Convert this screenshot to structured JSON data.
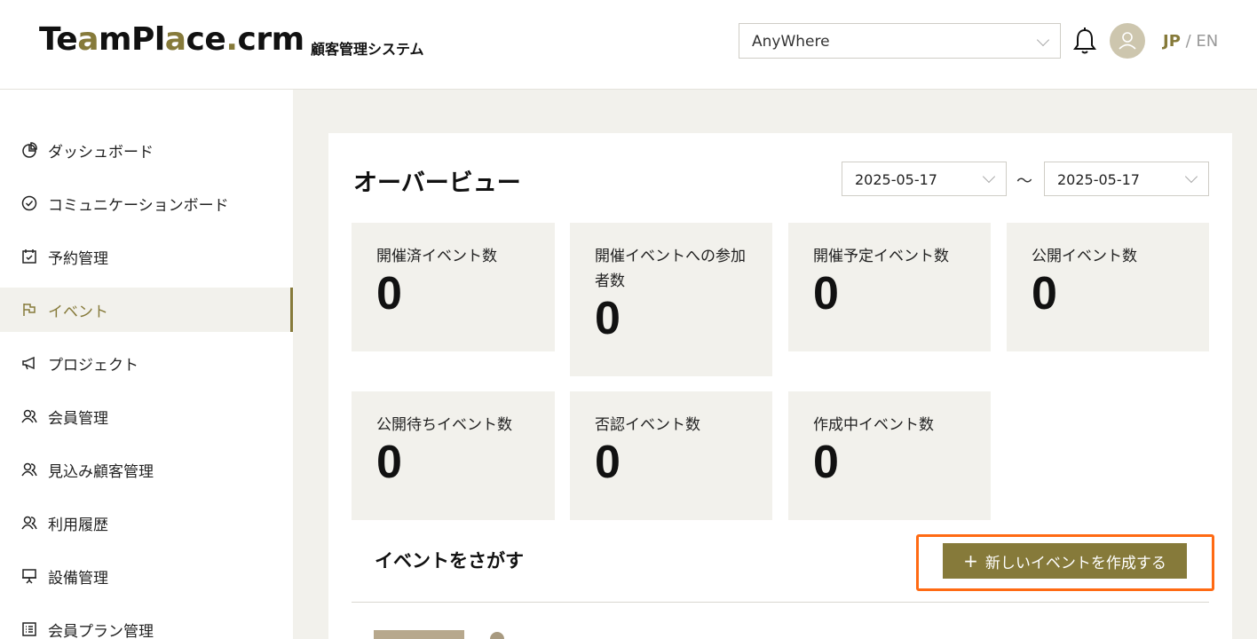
{
  "header": {
    "logo_part1": "Te",
    "logo_accent": "a",
    "logo_part2": "mPl",
    "logo_accent2": "a",
    "logo_part3": "ce",
    "logo_dot": ".",
    "logo_part4": "crm",
    "subtitle": "顧客管理システム",
    "org_select_value": "AnyWhere",
    "lang_jp": "JP",
    "lang_separator": " / ",
    "lang_en": "EN"
  },
  "sidebar": {
    "items": [
      {
        "label": "ダッシュボード",
        "icon": "pie-chart-icon"
      },
      {
        "label": "コミュニケーションボード",
        "icon": "check-circle-icon"
      },
      {
        "label": "予約管理",
        "icon": "calendar-check-icon"
      },
      {
        "label": "イベント",
        "icon": "flag-icon",
        "active": true
      },
      {
        "label": "プロジェクト",
        "icon": "megaphone-icon"
      },
      {
        "label": "会員管理",
        "icon": "users-icon"
      },
      {
        "label": "見込み顧客管理",
        "icon": "users-icon"
      },
      {
        "label": "利用履歴",
        "icon": "users-icon"
      },
      {
        "label": "設備管理",
        "icon": "presentation-icon"
      },
      {
        "label": "会員プラン管理",
        "icon": "list-icon"
      }
    ]
  },
  "overview": {
    "title": "オーバービュー",
    "date_from": "2025-05-17",
    "date_separator": "～",
    "date_to": "2025-05-17",
    "stats": [
      {
        "label": "開催済イベント数",
        "value": "0"
      },
      {
        "label": "開催イベントへの参加者数",
        "value": "0"
      },
      {
        "label": "開催予定イベント数",
        "value": "0"
      },
      {
        "label": "公開イベント数",
        "value": "0"
      },
      {
        "label": "公開待ちイベント数",
        "value": "0"
      },
      {
        "label": "否認イベント数",
        "value": "0"
      },
      {
        "label": "作成中イベント数",
        "value": "0"
      }
    ]
  },
  "events": {
    "search_title": "イベントをさがす",
    "create_plus": "+",
    "create_label": "新しいイベントを作成する"
  },
  "colors": {
    "accent": "#867a3a",
    "highlight": "#ff6a13",
    "panel_bg": "#f2f1ec"
  }
}
